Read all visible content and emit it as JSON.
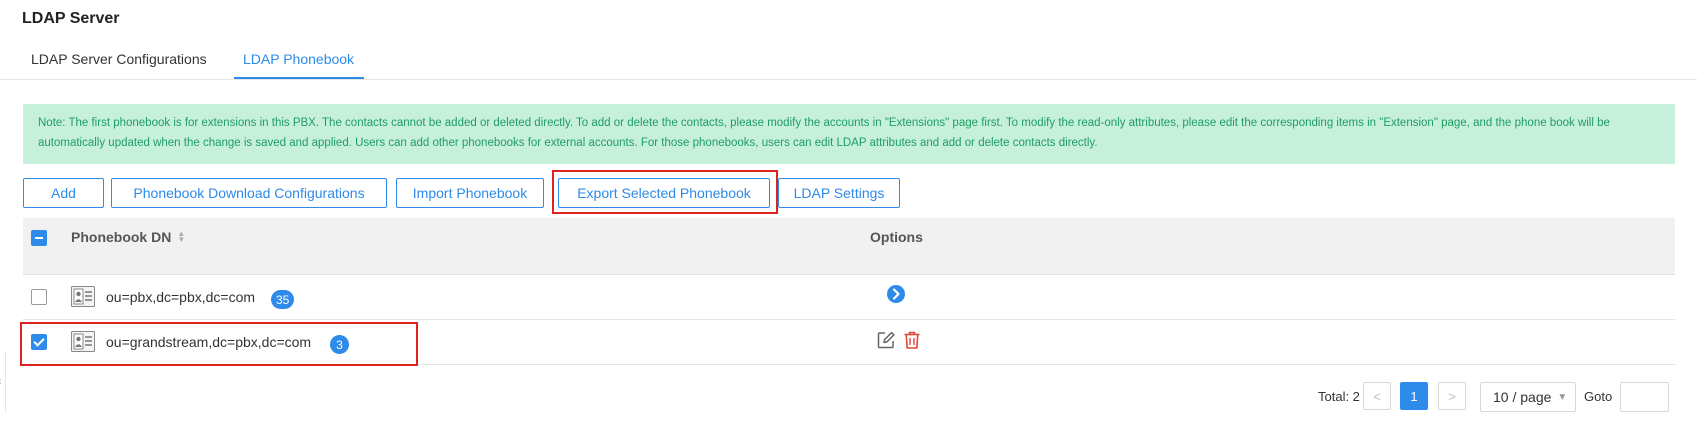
{
  "page": {
    "title": "LDAP Server"
  },
  "tabs": [
    {
      "label": "LDAP Server Configurations",
      "active": false
    },
    {
      "label": "LDAP Phonebook",
      "active": true
    }
  ],
  "note": "Note: The first phonebook is for extensions in this PBX. The contacts cannot be added or deleted directly. To add or delete the contacts, please modify the accounts in \"Extensions\" page first. To modify the read-only attributes, please edit the corresponding items in \"Extension\" page, and the phone book will be automatically updated when the change is saved and applied. Users can add other phonebooks for external accounts. For those phonebooks, users can edit LDAP attributes and add or delete contacts directly.",
  "toolbar": {
    "add": "Add",
    "download_config": "Phonebook Download Configurations",
    "import": "Import Phonebook",
    "export": "Export Selected Phonebook",
    "ldap_settings": "LDAP Settings"
  },
  "table": {
    "columns": {
      "dn": "Phonebook DN",
      "options": "Options"
    },
    "rows": [
      {
        "dn": "ou=pbx,dc=pbx,dc=com",
        "count": "35",
        "checked": false
      },
      {
        "dn": "ou=grandstream,dc=pbx,dc=com",
        "count": "3",
        "checked": true
      }
    ]
  },
  "pagination": {
    "total": "Total: 2",
    "prev": "<",
    "current_page": "1",
    "next": ">",
    "page_size": "10 / page",
    "goto_label": "Goto",
    "goto_value": ""
  },
  "colors": {
    "accent": "#2e8bea",
    "highlight": "#dd2222",
    "note_bg": "#c7f0dc",
    "note_text": "#1e9e63",
    "delete": "#e0473a"
  },
  "icons": [
    "sort-icon",
    "contact-card-icon",
    "arrow-right-circle-icon",
    "edit-icon",
    "trash-icon",
    "chevron-down-icon"
  ]
}
